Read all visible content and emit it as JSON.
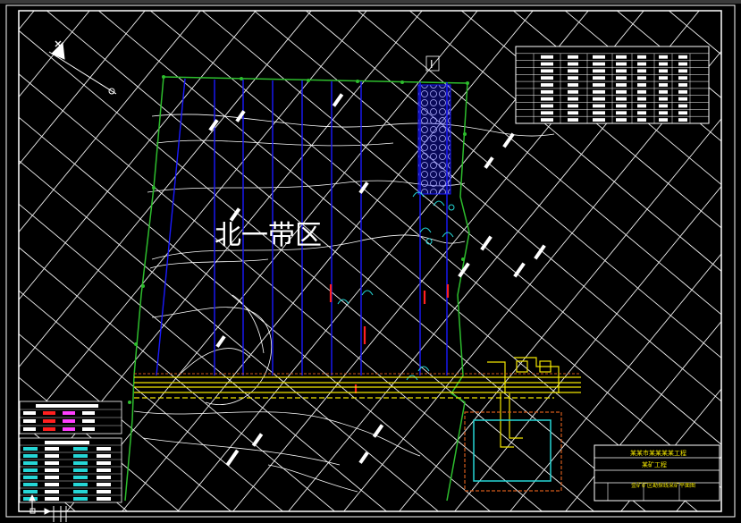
{
  "drawing": {
    "region_label": "北一带区",
    "section_marker": "I",
    "title_block": {
      "line1": "某某市某某某某工程",
      "line2": "某矿工程",
      "line3": "金矿矿区勘探线采矿平面图"
    },
    "colors": {
      "background": "#000000",
      "frame": "#ffffff",
      "grid": "#ffffff",
      "boundary": "#2dbd2d",
      "exploration_line": "#1a1aff",
      "road": "#f2e600",
      "pond": "#d35a1a",
      "pond_inner": "#1fb5a8",
      "red_mark": "#ff2020",
      "contour": "#ffffff",
      "cyan": "#26d6d6"
    },
    "icons": {
      "north_arrow": "north-arrow-icon",
      "ucs": "ucs-axis-icon"
    }
  }
}
